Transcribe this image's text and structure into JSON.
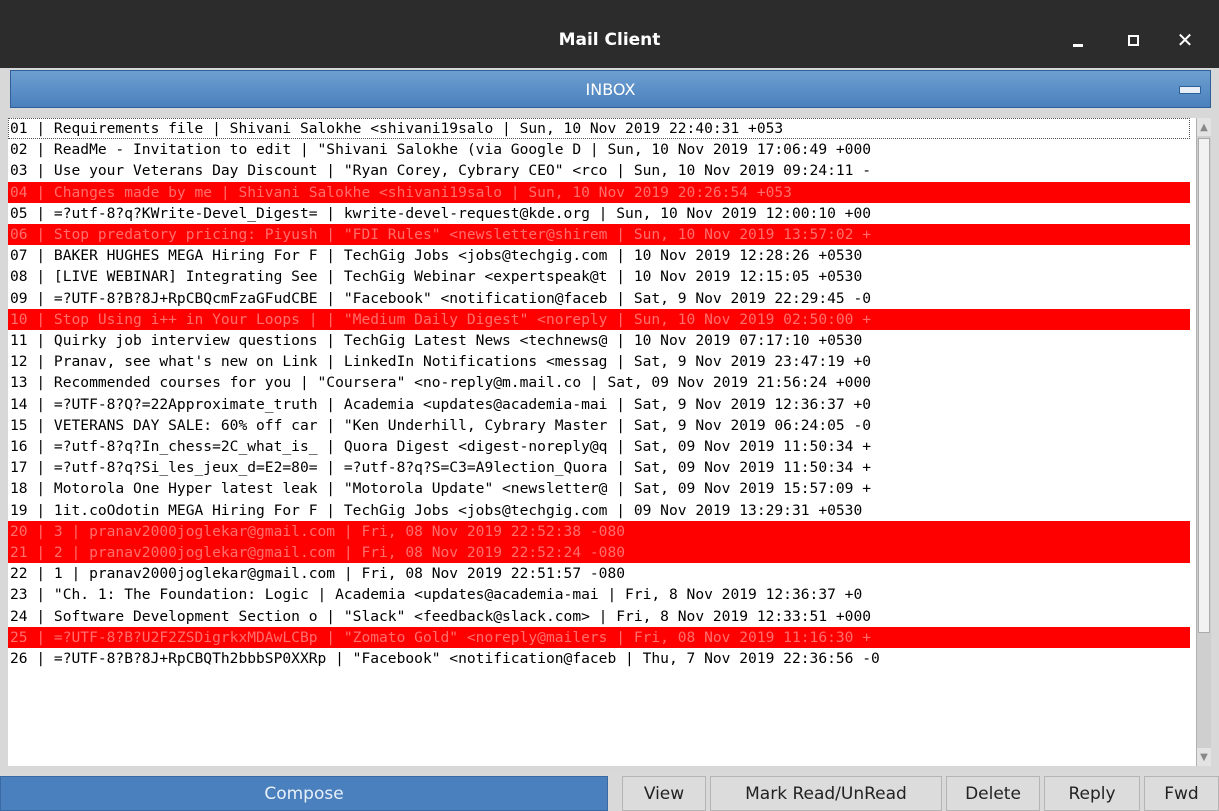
{
  "window": {
    "title": "Mail Client"
  },
  "inbox": {
    "title": "INBOX"
  },
  "colors": {
    "unread_bg": "#ff0000",
    "unread_text": "#ff6d6d",
    "accent": "#4a80bd",
    "titlebar": "#2c2c2c"
  },
  "emails": [
    {
      "text": "01 | Requirements file | Shivani Salokhe <shivani19salo | Sun, 10 Nov 2019 22:40:31 +053",
      "unread": false
    },
    {
      "text": "02 | ReadMe - Invitation to edit | \"Shivani Salokhe (via Google D | Sun, 10 Nov 2019 17:06:49 +000",
      "unread": false
    },
    {
      "text": "03 | Use your Veterans Day Discount | \"Ryan Corey, Cybrary CEO\" <rco | Sun, 10 Nov 2019 09:24:11 -",
      "unread": false
    },
    {
      "text": "04 | Changes made by me | Shivani Salokhe <shivani19salo | Sun, 10 Nov 2019 20:26:54 +053",
      "unread": true
    },
    {
      "text": "05 | =?utf-8?q?KWrite-Devel_Digest= | kwrite-devel-request@kde.org | Sun, 10 Nov 2019 12:00:10 +00",
      "unread": false
    },
    {
      "text": "06 | Stop predatory pricing: Piyush | \"FDI Rules\" <newsletter@shirem | Sun, 10 Nov 2019 13:57:02 +",
      "unread": true
    },
    {
      "text": "07 | BAKER HUGHES MEGA Hiring For F | TechGig Jobs <jobs@techgig.com | 10 Nov 2019 12:28:26 +0530",
      "unread": false
    },
    {
      "text": "08 | [LIVE WEBINAR] Integrating See | TechGig Webinar <expertspeak@t | 10 Nov 2019 12:15:05 +0530",
      "unread": false
    },
    {
      "text": "09 | =?UTF-8?B?8J+RpCBQcmFzaGFudCBE | \"Facebook\" <notification@faceb | Sat, 9 Nov 2019 22:29:45 -0",
      "unread": false
    },
    {
      "text": "10 | Stop Using i++ in Your Loops | | \"Medium Daily Digest\" <noreply | Sun, 10 Nov 2019 02:50:00 +",
      "unread": true
    },
    {
      "text": "11 | Quirky job interview questions | TechGig Latest News <technews@ | 10 Nov 2019 07:17:10 +0530",
      "unread": false
    },
    {
      "text": "12 | Pranav, see what's new on Link | LinkedIn Notifications <messag | Sat, 9 Nov 2019 23:47:19 +0",
      "unread": false
    },
    {
      "text": "13 | Recommended courses for you | \"Coursera\" <no-reply@m.mail.co | Sat, 09 Nov 2019 21:56:24 +000",
      "unread": false
    },
    {
      "text": "14 | =?UTF-8?Q?=22Approximate_truth | Academia <updates@academia-mai | Sat, 9 Nov 2019 12:36:37 +0",
      "unread": false
    },
    {
      "text": "15 | VETERANS DAY SALE: 60% off car | \"Ken Underhill, Cybrary Master | Sat, 9 Nov 2019 06:24:05 -0",
      "unread": false
    },
    {
      "text": "16 | =?utf-8?q?In_chess=2C_what_is_ | Quora Digest <digest-noreply@q | Sat, 09 Nov 2019 11:50:34 +",
      "unread": false
    },
    {
      "text": "17 | =?utf-8?q?Si_les_jeux_d=E2=80= | =?utf-8?q?S=C3=A9lection_Quora | Sat, 09 Nov 2019 11:50:34 +",
      "unread": false
    },
    {
      "text": "18 | Motorola One Hyper latest leak | \"Motorola Update\" <newsletter@ | Sat, 09 Nov 2019 15:57:09 +",
      "unread": false
    },
    {
      "text": "19 | 1it.coOdotin MEGA Hiring For F | TechGig Jobs <jobs@techgig.com | 09 Nov 2019 13:29:31 +0530",
      "unread": false
    },
    {
      "text": "20 | 3 | pranav2000joglekar@gmail.com | Fri, 08 Nov 2019 22:52:38 -080",
      "unread": true
    },
    {
      "text": "21 | 2 | pranav2000joglekar@gmail.com | Fri, 08 Nov 2019 22:52:24 -080",
      "unread": true
    },
    {
      "text": "22 | 1 | pranav2000joglekar@gmail.com | Fri, 08 Nov 2019 22:51:57 -080",
      "unread": false
    },
    {
      "text": "23 | \"Ch. 1: The Foundation: Logic | Academia <updates@academia-mai | Fri, 8 Nov 2019 12:36:37 +0",
      "unread": false
    },
    {
      "text": "24 | Software Development Section o | \"Slack\" <feedback@slack.com> | Fri, 8 Nov 2019 12:33:51 +000",
      "unread": false
    },
    {
      "text": "25 | =?UTF-8?B?U2F2ZSDigrkxMDAwLCBp | \"Zomato Gold\" <noreply@mailers | Fri, 08 Nov 2019 11:16:30 +",
      "unread": true
    },
    {
      "text": "26 | =?UTF-8?B?8J+RpCBQTh2bbbSP0XXRp | \"Facebook\" <notification@faceb | Thu, 7 Nov 2019 22:36:56 -0",
      "unread": false
    }
  ],
  "buttons": {
    "compose": "Compose",
    "view": "View",
    "mark": "Mark Read/UnRead",
    "delete": "Delete",
    "reply": "Reply",
    "fwd": "Fwd"
  }
}
